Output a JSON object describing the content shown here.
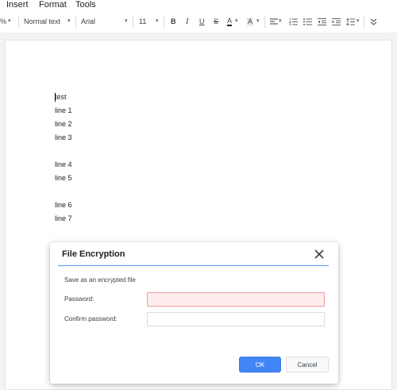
{
  "menu": {
    "items": [
      "Insert",
      "Format",
      "Tools"
    ]
  },
  "toolbar": {
    "zoom_partial": "%",
    "style_select": "Normal text",
    "font_select": "Arial",
    "font_size": "11",
    "bold": "B",
    "italic": "I",
    "underline": "U",
    "strikethrough": "S",
    "text_color": "A",
    "highlight": "A",
    "accent_red": "#d93025"
  },
  "document": {
    "lines": [
      "test",
      "line 1",
      "line 2",
      "line 3",
      "",
      "line 4",
      "line 5",
      "",
      "line 6",
      "line 7"
    ]
  },
  "dialog": {
    "title": "File Encryption",
    "subtitle": "Save as an encrypted file",
    "password_label": "Password:",
    "password_value": "",
    "confirm_label": "Confirm password:",
    "confirm_value": "",
    "ok_label": "OK",
    "cancel_label": "Cancel",
    "accent": "#1a73e8",
    "ok_color": "#4285f4",
    "error_bg": "#fdecee"
  }
}
